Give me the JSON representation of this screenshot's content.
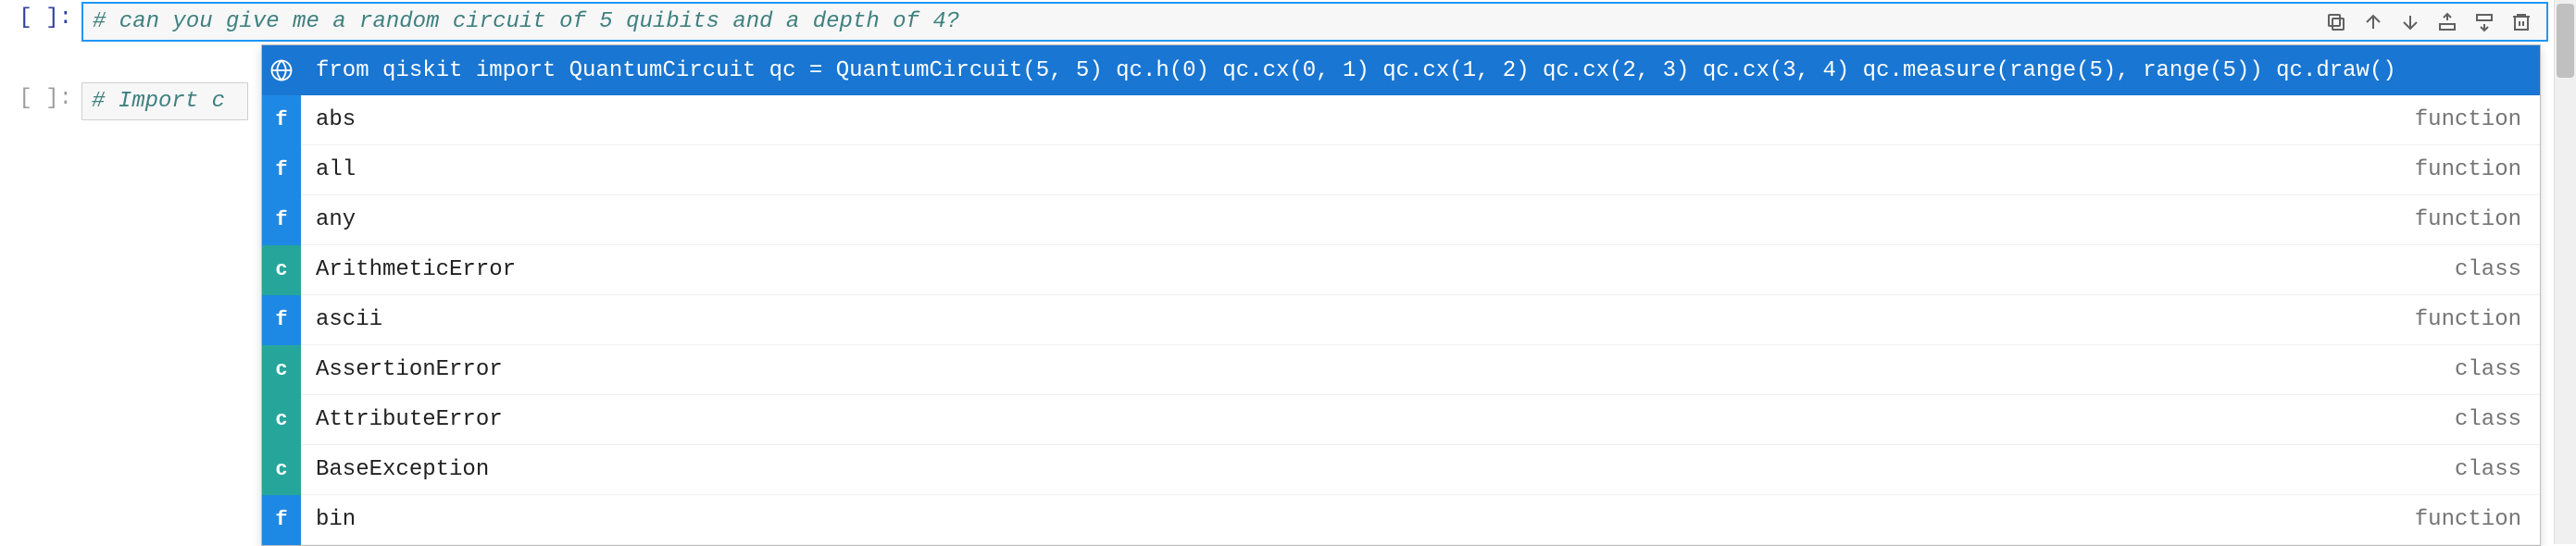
{
  "cells": [
    {
      "prompt": "[ ]:",
      "code": "# can you give me a random circuit of 5 quibits and a depth of 4?",
      "active": true
    },
    {
      "prompt": "[ ]:",
      "code": "# Import c",
      "active": false
    }
  ],
  "toolbar_icons": {
    "duplicate": "duplicate",
    "up": "up",
    "down": "down",
    "insert_above": "insert-above",
    "insert_below": "insert-below",
    "delete": "delete"
  },
  "autocomplete": {
    "selected_index": 0,
    "items": [
      {
        "badge": "globe",
        "label": "from qiskit import QuantumCircuit qc = QuantumCircuit(5, 5) qc.h(0) qc.cx(0, 1) qc.cx(1, 2) qc.cx(2, 3) qc.cx(3, 4) qc.measure(range(5), range(5)) qc.draw()",
        "type": ""
      },
      {
        "badge": "f",
        "label": "abs",
        "type": "function"
      },
      {
        "badge": "f",
        "label": "all",
        "type": "function"
      },
      {
        "badge": "f",
        "label": "any",
        "type": "function"
      },
      {
        "badge": "c",
        "label": "ArithmeticError",
        "type": "class"
      },
      {
        "badge": "f",
        "label": "ascii",
        "type": "function"
      },
      {
        "badge": "c",
        "label": "AssertionError",
        "type": "class"
      },
      {
        "badge": "c",
        "label": "AttributeError",
        "type": "class"
      },
      {
        "badge": "c",
        "label": "BaseException",
        "type": "class"
      },
      {
        "badge": "f",
        "label": "bin",
        "type": "function"
      }
    ]
  }
}
